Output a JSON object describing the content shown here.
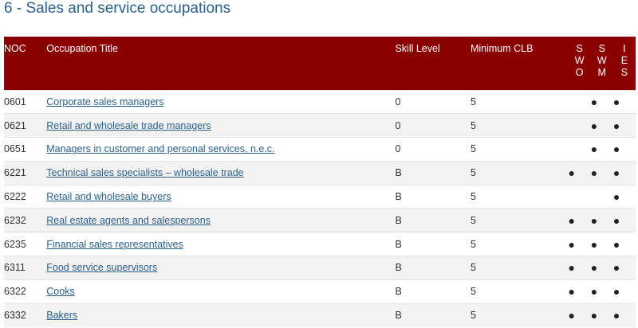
{
  "page": {
    "title": "6 - Sales and service occupations"
  },
  "colors": {
    "header_bg": "#8b0000",
    "title_color": "#2b5f8c",
    "link_color": "#2b5f8c",
    "stripe": "#f3f3f3"
  },
  "table": {
    "headers": {
      "noc": "NOC",
      "title": "Occupation Title",
      "skill": "Skill Level",
      "clb": "Minimum CLB",
      "swo": [
        "S",
        "W",
        "O"
      ],
      "swm": [
        "S",
        "W",
        "M"
      ],
      "ies": [
        "I",
        "E",
        "S"
      ]
    },
    "bullet": "●",
    "rows": [
      {
        "noc": "0601",
        "title": "Corporate sales managers",
        "skill": "0",
        "clb": "5",
        "swo": "",
        "swm": "●",
        "ies": "●"
      },
      {
        "noc": "0621",
        "title": "Retail and wholesale trade managers",
        "skill": "0",
        "clb": "5",
        "swo": "",
        "swm": "●",
        "ies": "●"
      },
      {
        "noc": "0651",
        "title": "Managers in customer and personal services, n.e.c.",
        "skill": "0",
        "clb": "5",
        "swo": "",
        "swm": "●",
        "ies": "●"
      },
      {
        "noc": "6221",
        "title": "Technical sales specialists – wholesale trade",
        "skill": "B",
        "clb": "5",
        "swo": "●",
        "swm": "●",
        "ies": "●"
      },
      {
        "noc": "6222",
        "title": "Retail and wholesale buyers",
        "skill": "B",
        "clb": "5",
        "swo": "",
        "swm": "",
        "ies": "●"
      },
      {
        "noc": "6232",
        "title": "Real estate agents and salespersons",
        "skill": "B",
        "clb": "5",
        "swo": "●",
        "swm": "●",
        "ies": "●"
      },
      {
        "noc": "6235",
        "title": "Financial sales representatives",
        "skill": "B",
        "clb": "5",
        "swo": "●",
        "swm": "●",
        "ies": "●"
      },
      {
        "noc": "6311",
        "title": "Food service supervisors",
        "skill": "B",
        "clb": "5",
        "swo": "●",
        "swm": "●",
        "ies": "●"
      },
      {
        "noc": "6322",
        "title": "Cooks",
        "skill": "B",
        "clb": "5",
        "swo": "●",
        "swm": "●",
        "ies": "●"
      },
      {
        "noc": "6332",
        "title": "Bakers",
        "skill": "B",
        "clb": "5",
        "swo": "●",
        "swm": "●",
        "ies": "●"
      }
    ]
  }
}
